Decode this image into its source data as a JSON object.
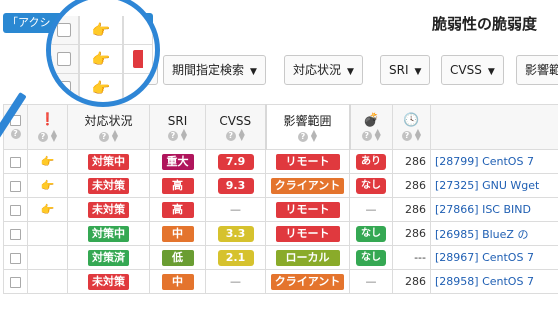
{
  "toolbar": {
    "action_label": "「アクシ",
    "action_dropdown_icon": "arrow-down-icon",
    "page_title": "脆弱性の脆弱度"
  },
  "filters": [
    {
      "label": "期間指定検索"
    },
    {
      "label": "対応状況"
    },
    {
      "label": "SRI"
    },
    {
      "label": "CVSS"
    },
    {
      "label": "影響範"
    }
  ],
  "table": {
    "headers": {
      "exploit_status": "対応状況",
      "sri": "SRI",
      "cvss": "CVSS",
      "impact": "影響範囲",
      "bomb_icon": "bomb-icon",
      "clock_icon": "clock-icon",
      "alert_icon": "exclamation-icon",
      "help": "?"
    },
    "rows": [
      {
        "hand": "👉",
        "status": "対策中",
        "status_color": "#e0393e",
        "sri": "重大",
        "sri_color": "#b0155c",
        "cvss": "7.9",
        "cvss_color": "#e0393e",
        "impact": "リモート",
        "impact_color": "#e0393e",
        "exploit": "あり",
        "exploit_color": "#e0393e",
        "days": "286",
        "link": "[28799] CentOS 7"
      },
      {
        "hand": "👉",
        "status": "未対策",
        "status_color": "#e0393e",
        "sri": "高",
        "sri_color": "#e0393e",
        "cvss": "9.3",
        "cvss_color": "#e0393e",
        "impact": "クライアント",
        "impact_color": "#e4742d",
        "exploit": "なし",
        "exploit_color": "#e0393e",
        "days": "286",
        "link": "[27325] GNU Wget"
      },
      {
        "hand": "👉",
        "status": "未対策",
        "status_color": "#e0393e",
        "sri": "高",
        "sri_color": "#e0393e",
        "cvss": "—",
        "cvss_color": "",
        "impact": "リモート",
        "impact_color": "#e0393e",
        "exploit": "—",
        "exploit_color": "",
        "days": "286",
        "link": "[27866] ISC BIND"
      },
      {
        "hand": "",
        "status": "対策中",
        "status_color": "#35a853",
        "sri": "中",
        "sri_color": "#e4742d",
        "cvss": "3.3",
        "cvss_color": "#d6c22e",
        "impact": "リモート",
        "impact_color": "#e0393e",
        "exploit": "なし",
        "exploit_color": "#35a853",
        "days": "286",
        "link": "[26985] BlueZ の"
      },
      {
        "hand": "",
        "status": "対策済",
        "status_color": "#35a853",
        "sri": "低",
        "sri_color": "#6a9d32",
        "cvss": "2.1",
        "cvss_color": "#d6c22e",
        "impact": "ローカル",
        "impact_color": "#8aab2a",
        "exploit": "なし",
        "exploit_color": "#35a853",
        "days": "---",
        "link": "[28967] CentOS 7"
      },
      {
        "hand": "",
        "status": "未対策",
        "status_color": "#e0393e",
        "sri": "中",
        "sri_color": "#e4742d",
        "cvss": "—",
        "cvss_color": "",
        "impact": "クライアント",
        "impact_color": "#e4742d",
        "exploit": "—",
        "exploit_color": "",
        "days": "286",
        "link": "[28958] CentOS 7"
      }
    ]
  },
  "magnifier": {
    "hand_icon": "pointing-hand-icon",
    "rows": 3
  }
}
